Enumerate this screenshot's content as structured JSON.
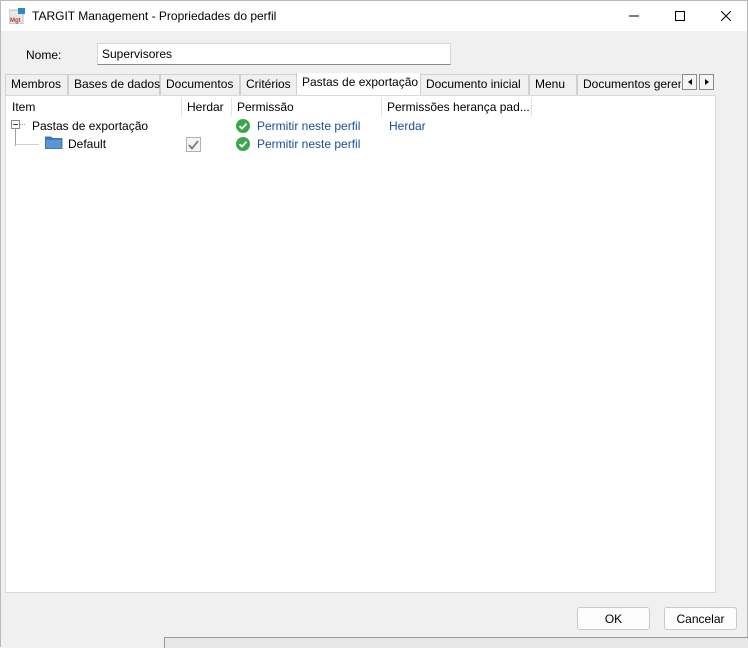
{
  "window": {
    "title": "TARGIT Management - Propriedades do perfil",
    "app_icon_text": "Mgt"
  },
  "name_field": {
    "label": "Nome:",
    "value": "Supervisores"
  },
  "tabs": [
    {
      "label": "Membros",
      "active": false
    },
    {
      "label": "Bases de dados",
      "active": false
    },
    {
      "label": "Documentos",
      "active": false
    },
    {
      "label": "Critérios",
      "active": false
    },
    {
      "label": "Pastas de exportação",
      "active": true
    },
    {
      "label": "Documento inicial",
      "active": false
    },
    {
      "label": "Menu",
      "active": false
    },
    {
      "label": "Documentos gerenciados",
      "active": false
    }
  ],
  "columns": {
    "item": "Item",
    "inherit": "Herdar",
    "permission": "Permissão",
    "default_inheritance": "Permissões herança pad..."
  },
  "rows": [
    {
      "item": "Pastas de exportação",
      "inherit_checked": false,
      "permission": "Permitir neste perfil",
      "default_inheritance": "Herdar"
    },
    {
      "item": "Default",
      "inherit_checked": true,
      "permission": "Permitir neste perfil",
      "default_inheritance": ""
    }
  ],
  "buttons": {
    "ok": "OK",
    "cancel": "Cancelar"
  },
  "colors": {
    "link": "#1a4da0",
    "check_green": "#3aa84a",
    "folder_blue": "#3f7bc4"
  }
}
